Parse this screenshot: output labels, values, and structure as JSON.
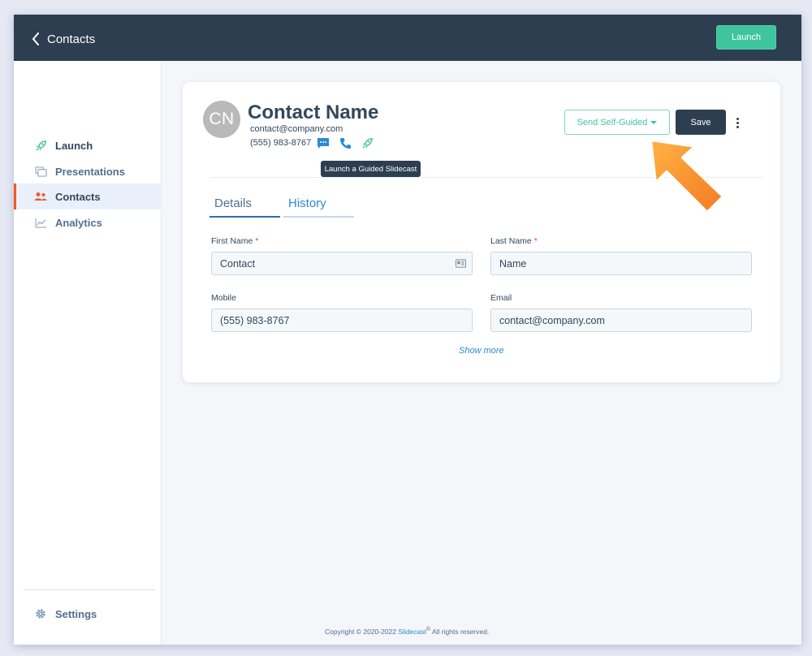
{
  "header": {
    "back_label": "Contacts",
    "launch_label": "Launch"
  },
  "sidebar": {
    "items": [
      {
        "label": "Launch",
        "icon": "rocket-icon"
      },
      {
        "label": "Presentations",
        "icon": "presentations-icon"
      },
      {
        "label": "Contacts",
        "icon": "contacts-icon",
        "active": true
      },
      {
        "label": "Analytics",
        "icon": "analytics-icon"
      }
    ],
    "settings_label": "Settings"
  },
  "contact": {
    "initials": "CN",
    "name": "Contact Name",
    "email": "contact@company.com",
    "phone": "(555) 983-8767"
  },
  "tooltip": "Launch a Guided Slidecast",
  "actions": {
    "send_label": "Send Self-Guided",
    "save_label": "Save"
  },
  "tabs": [
    {
      "label": "Details",
      "active": true
    },
    {
      "label": "History"
    }
  ],
  "form": {
    "first_name": {
      "label": "First Name",
      "required": "*",
      "value": "Contact"
    },
    "last_name": {
      "label": "Last Name",
      "required": "*",
      "value": "Name"
    },
    "mobile": {
      "label": "Mobile",
      "value": "(555) 983-8767"
    },
    "email": {
      "label": "Email",
      "value": "contact@company.com"
    },
    "show_more": "Show more"
  },
  "footer": {
    "prefix": "Copyright © 2020-2022 ",
    "brand": "Slidecast",
    "reg": "®",
    "suffix": " All rights reserved."
  },
  "colors": {
    "header_bg": "#2d3e50",
    "accent_green": "#3fc59e",
    "active_orange": "#f05a28",
    "link_blue": "#2a8bd1",
    "callout_arrow": "#f7941d"
  }
}
